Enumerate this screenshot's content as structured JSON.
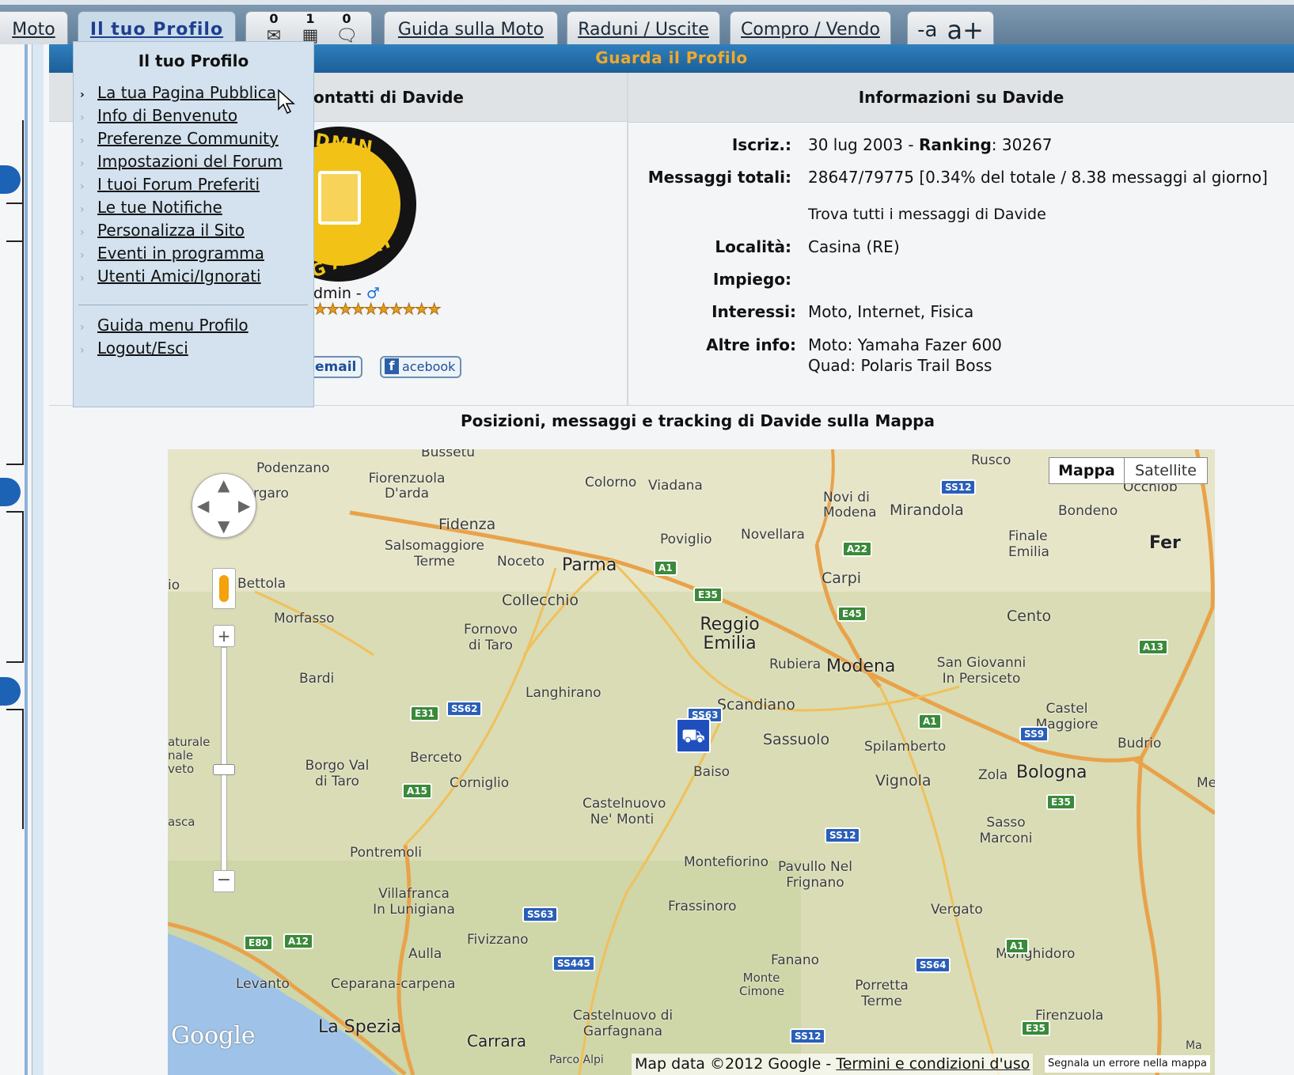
{
  "nav": {
    "tabs": [
      "Moto",
      "Il tuo Profilo",
      "Guida sulla Moto",
      "Raduni / Uscite",
      "Compro / Vendo"
    ],
    "counters": [
      {
        "value": "0",
        "icon": "envelope-icon"
      },
      {
        "value": "1",
        "icon": "calendar-icon"
      },
      {
        "value": "0",
        "icon": "chat-bubble-icon"
      }
    ],
    "font_minus": "-a",
    "font_plus": "a+"
  },
  "panel": {
    "title": "Guarda il Profilo",
    "contacts_header": "ontatti di Davide",
    "info_header": "Informazioni su Davide",
    "avatar_text_top": "DMIN",
    "avatar_text_bottom": "G'AVERT",
    "role_text": "dmin -",
    "gender_symbol": "♂",
    "stars": "★★★★★★★★★★",
    "email_label": "email",
    "facebook_label": "acebook"
  },
  "info": {
    "iscriz_label": "Iscriz.:",
    "iscriz_value": "30 lug 2003",
    "ranking_label": "Ranking",
    "ranking_value": ": 30267",
    "messaggi_label": "Messaggi totali:",
    "messaggi_value": "28647/79775 [0.34% del totale / 8.38 messaggi al giorno]",
    "trova_link": "Trova tutti i messaggi di Davide",
    "localita_label": "Località:",
    "localita_value": "Casina (RE)",
    "impiego_label": "Impiego:",
    "interessi_label": "Interessi:",
    "interessi_value": "Moto, Internet, Fisica",
    "altre_label": "Altre info:",
    "altre_value_1": "Moto: Yamaha Fazer 600",
    "altre_value_2": "Quad: Polaris Trail Boss"
  },
  "dropdown": {
    "title": "Il tuo Profilo",
    "items": [
      "La tua Pagina Pubblica",
      "Info di Benvenuto",
      "Preferenze Community",
      "Impostazioni del Forum",
      "I tuoi Forum Preferiti",
      "Le tue Notifiche",
      "Personalizza il Sito",
      "Eventi in programma",
      "Utenti Amici/Ignorati"
    ],
    "items2": [
      "Guida menu Profilo",
      "Logout/Esci"
    ]
  },
  "map": {
    "heading": "Posizioni, messaggi e tracking di Davide sulla Mappa",
    "type_map": "Mappa",
    "type_satellite": "Satellite",
    "attribution": "Map data ©2012 Google -",
    "terms": "Termini e condizioni d'uso",
    "report": "Segnala un errore nella mappa",
    "logo": "Google",
    "cities": [
      "Bussetu",
      "Podenzano",
      "Fiorenzuola D'arda",
      "Colorno",
      "Viadana",
      "Rusco",
      "Novi di Modena",
      "Mirandola",
      "Bondeno",
      "Occhiob",
      "rgaro",
      "Fidenza",
      "Salsomaggiore Terme",
      "Noceto",
      "Parma",
      "Poviglio",
      "Novellara",
      "Carpi",
      "Finale Emilia",
      "Fer",
      "Bettola",
      "io",
      "Collecchio",
      "Morfasso",
      "Fornovo di Taro",
      "Reggio Emilia",
      "Rubiera",
      "Modena",
      "Cento",
      "San Giovanni In Persiceto",
      "Bardi",
      "Langhirano",
      "Scandiano",
      "Sassuolo",
      "Spilamberto",
      "Castel Maggiore",
      "Budrio",
      "aturale nale veto",
      "Borgo Val di Taro",
      "Berceto",
      "Corniglio",
      "Baiso",
      "Vignola",
      "Zola",
      "Bologna",
      "Me",
      "asca",
      "Castelnuovo Ne' Monti",
      "Sasso Marconi",
      "Pontremoli",
      "Montefiorino",
      "Pavullo Nel Frignano",
      "Villafranca In Lunigiana",
      "Frassinoro",
      "Vergato",
      "Fivizzano",
      "Aulla",
      "Fanano",
      "Monghidoro",
      "Levanto",
      "Ceparana-carpena",
      "Monte Cimone",
      "Porretta Terme",
      "La Spezia",
      "Castelnuovo di Garfagnana",
      "Firenzuola",
      "Carrara",
      "Parco Alpi",
      "Ma"
    ],
    "shields": [
      "SS12",
      "A22",
      "A1",
      "E35",
      "E45",
      "A13",
      "A1",
      "SS9",
      "E31",
      "SS62",
      "SS63",
      "A15",
      "E35",
      "SS12",
      "SS63",
      "SS445",
      "E80",
      "A12",
      "SS64",
      "A1",
      "E35",
      "SS12"
    ]
  }
}
